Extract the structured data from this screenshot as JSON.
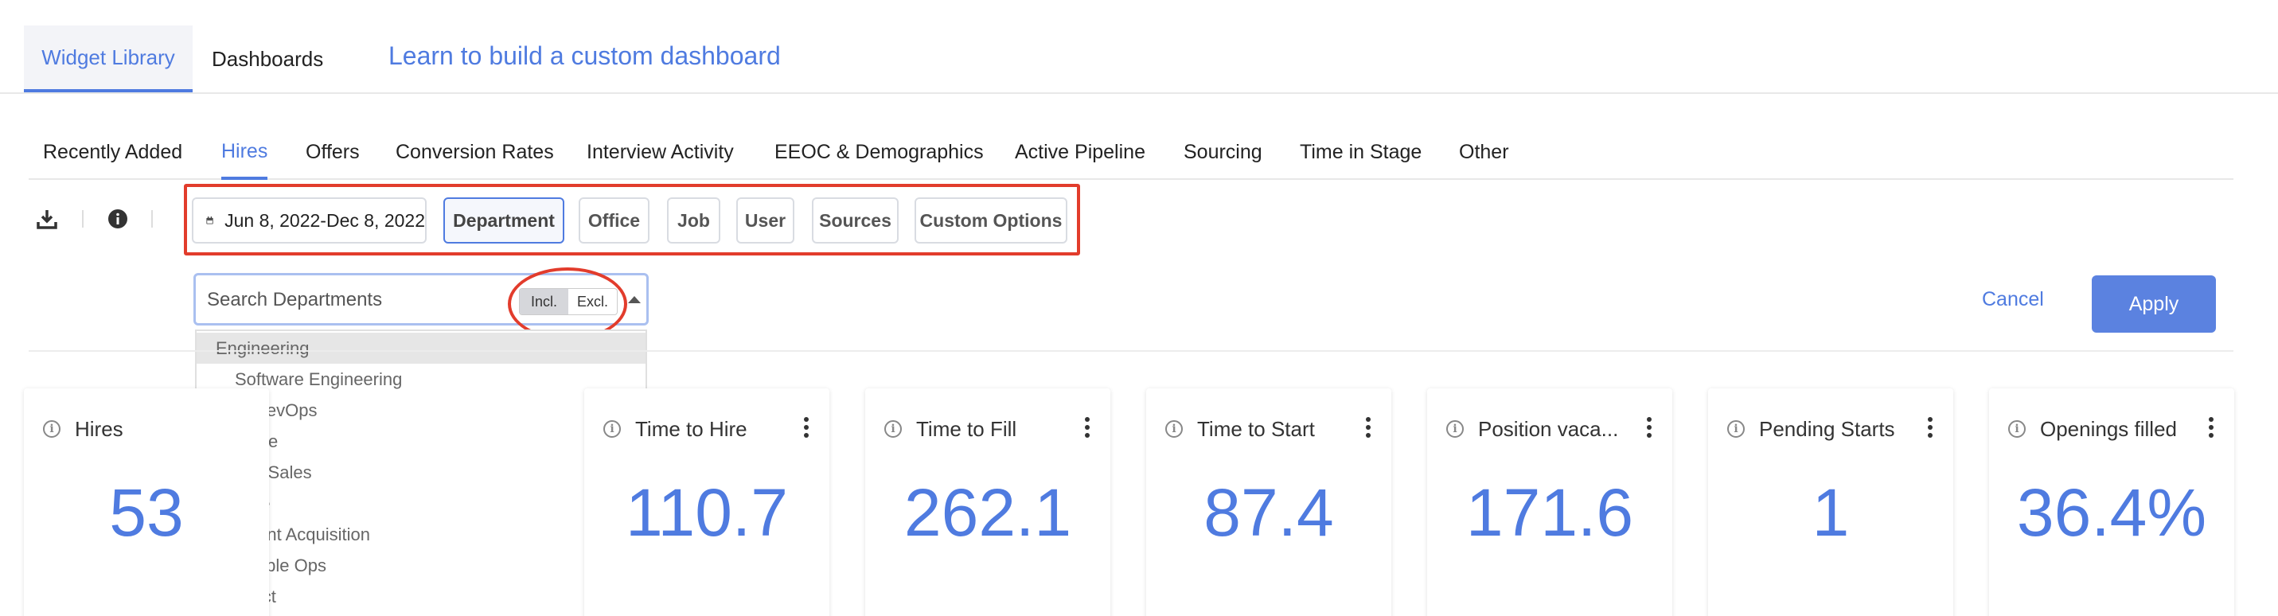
{
  "top_tabs": {
    "widget_library": "Widget Library",
    "dashboards": "Dashboards",
    "learn_link": "Learn to build a custom dashboard"
  },
  "sub_tabs": [
    "Recently Added",
    "Hires",
    "Offers",
    "Conversion Rates",
    "Interview Activity",
    "EEOC & Demographics",
    "Active Pipeline",
    "Sourcing",
    "Time in Stage",
    "Other"
  ],
  "active_sub_tab": "Hires",
  "toolbar": {
    "download_icon": "download-icon",
    "info_icon": "info-icon"
  },
  "filters": {
    "date_range": "Jun 8, 2022-Dec 8, 2022",
    "department": "Department",
    "office": "Office",
    "job": "Job",
    "user": "User",
    "sources": "Sources",
    "custom_options": "Custom Options"
  },
  "search": {
    "placeholder": "Search Departments",
    "incl": "Incl.",
    "excl": "Excl."
  },
  "departments": [
    {
      "label": "Engineering",
      "level": 0,
      "highlighted": true
    },
    {
      "label": "Software Engineering",
      "level": 1
    },
    {
      "label": "DevOps",
      "level": 2
    },
    {
      "label": "Finance",
      "level": 0
    },
    {
      "label": "Pre-Sales",
      "level": 1
    },
    {
      "label": "People",
      "level": 0
    },
    {
      "label": "Talent Acquisition",
      "level": 1
    },
    {
      "label": "People Ops",
      "level": 1
    },
    {
      "label": "Product",
      "level": 0
    }
  ],
  "actions": {
    "cancel": "Cancel",
    "apply": "Apply"
  },
  "cards": [
    {
      "title": "Hires",
      "value": "53"
    },
    {
      "title": "Time to Hire",
      "value": "110.7"
    },
    {
      "title": "Time to Fill",
      "value": "262.1"
    },
    {
      "title": "Time to Start",
      "value": "87.4"
    },
    {
      "title": "Position vaca...",
      "value": "171.6"
    },
    {
      "title": "Pending Starts",
      "value": "1"
    },
    {
      "title": "Openings filled",
      "value": "36.4%"
    }
  ],
  "colors": {
    "accent": "#4f7be0",
    "annotation": "#e23c2c",
    "apply_bg": "#5b82e0"
  }
}
